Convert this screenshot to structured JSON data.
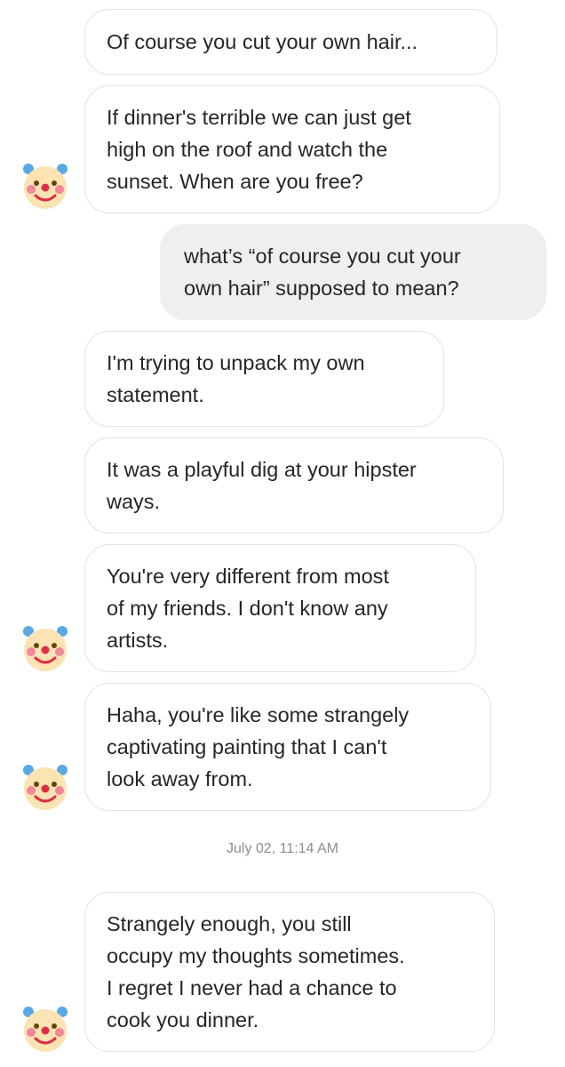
{
  "chat": {
    "messages": [
      {
        "direction": "incoming",
        "text": "Of course you cut your own hair..."
      },
      {
        "direction": "incoming",
        "text": "If dinner's terrible we can just get\nhigh on the roof and watch the\nsunset. When are you free?"
      },
      {
        "direction": "outgoing",
        "text": "what’s “of course you cut your\nown hair” supposed to mean?"
      },
      {
        "direction": "incoming",
        "text": "I'm trying to unpack my own\nstatement."
      },
      {
        "direction": "incoming",
        "text": "It was a playful dig at your hipster\nways."
      },
      {
        "direction": "incoming",
        "text": "You're very different from most\nof my friends. I don't know any\nartists."
      },
      {
        "direction": "incoming",
        "text": "Haha, you're like some strangely\ncaptivating painting that I can't\nlook away from."
      },
      {
        "direction": "incoming",
        "text": "Strangely enough, you still\noccupy my thoughts sometimes.\nI regret I never had a chance to\ncook you dinner."
      }
    ],
    "timestamp": "July 02, 11:14 AM",
    "avatar_icon": "clown-face-icon"
  }
}
